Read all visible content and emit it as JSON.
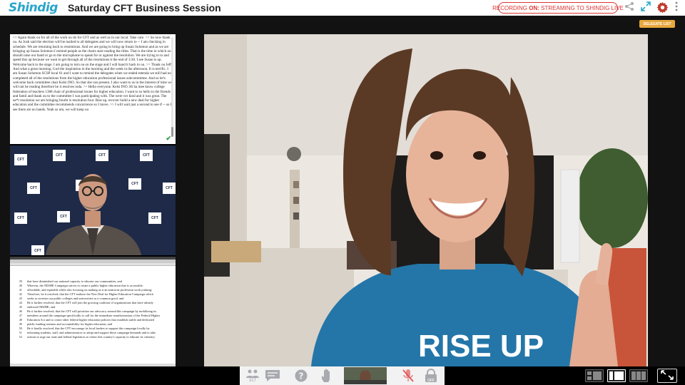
{
  "header": {
    "logo": "Shindig",
    "title": "Saturday CFT Business Session",
    "recording_label": "RECORDING",
    "recording_state": "ON:",
    "streaming_label": "STREAMING TO SHINDIG LIVE"
  },
  "delegate_button": "DELEGATE LIST",
  "captions": {
    "text": ">> Again thank ou for all of the work ou do for CFT and as well as in our local.  Take care. >> So now thank ou. As Josh said the election will be mailed to all delegates and we will now return to -- I am checking in schedule.  We are returning back to resolutions.  And we are going to bring up Susan Solomon and as we are bringing up Susan Solomon I remind people as the chairs start reading the titles.  That is the time in which ou should raise our hand or go to the microphone to speak for or against the resolution.  We are trying to to and speed this up because we want to get through all of the resolutions b the end of 3:30. I see Susan is up.  Welcome back to the stage.  I am going to turn ou on the stage and I will hand it back to ou. >> Thank ou Jeff.  And what a great morning.  God the inspiration in the morning and the week in the afternoon.  It is terrific.  I am Susan Solomon SCSP local 61 and I want to remind the delegates when we ended estenda we still had not completed all of the resolutions from the higher education professional issues subcommittee.  And so let's welcome back committee chair Kelsi INO. So that she can present.  I also want to us in the interest of time we will not be reading therefore be it resolves toda. >> Hello everyone.  Kelsi INO.  Hi ha mee know college federation of teachers 1388 chair of professional issues for higher education. I want to so hello to the friends and famil and thank ou to the committee I was participating with.  The were ver kind and it was great.  The ne*t resolution we are bringing fourht is resolution four.  Rise up, recover build a new deal for higher education and the committee recommends concurrence so I move. >> I will wait just a second to see if -- so I see there are no hands.  Yeah so um, we will keep ou"
  },
  "speaker_logos": [
    "CFT"
  ],
  "document": {
    "lines": [
      {
        "n": "39",
        "t": "that have diminished our national capacity to educate our communities; and"
      },
      {
        "n": "40",
        "t": "Whereas, the NDfHE Campaign strives to create a public higher education that is accessible,"
      },
      {
        "n": "41",
        "t": "affordable, and equitable while also focusing on making us it an antiracist profession work jointing;"
      },
      {
        "n": "42",
        "t": "Therefore, be it resolved, that the CFT endorse the New Deal for Higher Education Campaign which"
      },
      {
        "n": "43",
        "t": "seeks to recenter our public colleges and universities as a common good, and"
      },
      {
        "n": "44",
        "t": "Be it further resolved, that the CFT will join the growing coalition of organizations that have already"
      },
      {
        "n": "45",
        "t": "endorsed NDfHE; and"
      },
      {
        "n": "46",
        "t": "Be it further resolved, that the CFT will prioritize our advocacy around this campaign by mobilizing its"
      },
      {
        "n": "47",
        "t": "members around the campaign specifically to call for the immediate reauthorization of the Federal Higher"
      },
      {
        "n": "48",
        "t": "Education Act and to create other federal higher education policies that establish stable and dedicated"
      },
      {
        "n": "49",
        "t": "public funding streams and accountability for higher education; and"
      },
      {
        "n": "50",
        "t": "Be it finally resolved, that the CFT encourage its local leaders to support this campaign locally by"
      },
      {
        "n": "51",
        "t": "informing students, staff, and administrators to adopt and support these campaign demands and to take"
      },
      {
        "n": "52",
        "t": "actions to urge our state and federal legislators to renew this country's capacity to educate its citizenry."
      }
    ]
  },
  "main_video": {
    "shirt_text": "RISE UP"
  },
  "controls": {
    "attendee_count": "317",
    "mic_off_label": "OFF"
  },
  "colors": {
    "brand": "#2aa6c9",
    "recording": "#dd3333",
    "delegate": "#e8a73d",
    "gear": "#c0392b"
  }
}
